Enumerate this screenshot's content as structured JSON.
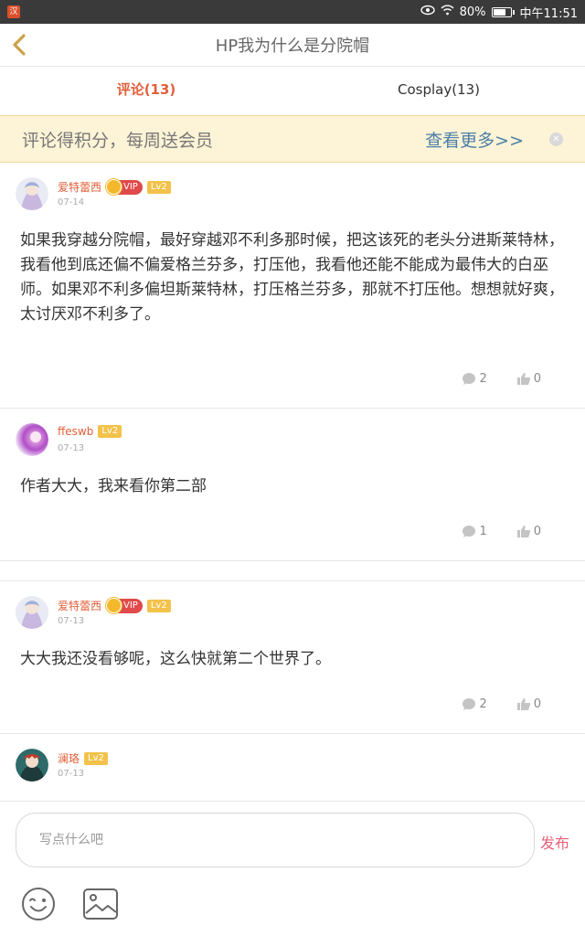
{
  "status_bar": {
    "battery": "80%",
    "time": "中午11:51",
    "battery_level": 0.8,
    "app_icon_text": "汉"
  },
  "header": {
    "title": "HP我为什么是分院帽"
  },
  "tabs": [
    {
      "label": "评论(13)",
      "active": true
    },
    {
      "label": "Cosplay(13)",
      "active": false
    }
  ],
  "banner": {
    "text": "评论得积分，每周送会员",
    "more": "查看更多>>"
  },
  "comments": [
    {
      "name": "爱特蕾西",
      "vip": "VIP",
      "level": "Lv2",
      "date": "07-14",
      "text": "如果我穿越分院帽，最好穿越邓不利多那时候，把这该死的老头分进斯莱特林，我看他到底还偏不偏爱格兰芬多，打压他，我看他还能不能成为最伟大的白巫师。如果邓不利多偏坦斯莱特林，打压格兰芬多，那就不打压他。想想就好爽，太讨厌邓不利多了。",
      "replies": "2",
      "likes": "0"
    },
    {
      "name": "ffeswb",
      "level": "Lv2",
      "date": "07-13",
      "text": "作者大大，我来看你第二部",
      "replies": "1",
      "likes": "0"
    },
    {
      "name": "爱特蕾西",
      "vip": "VIP",
      "level": "Lv2",
      "date": "07-13",
      "text": "大大我还没看够呢，这么快就第二个世界了。",
      "replies": "2",
      "likes": "0"
    },
    {
      "name": "澜珞",
      "level": "Lv2",
      "date": "07-13"
    }
  ],
  "input": {
    "placeholder": "写点什么吧",
    "publish": "发布"
  },
  "colors": {
    "accent": "#e0603a",
    "link": "#4a7fa8",
    "publish": "#e8607c",
    "banner_bg": "#fdf3d6"
  }
}
